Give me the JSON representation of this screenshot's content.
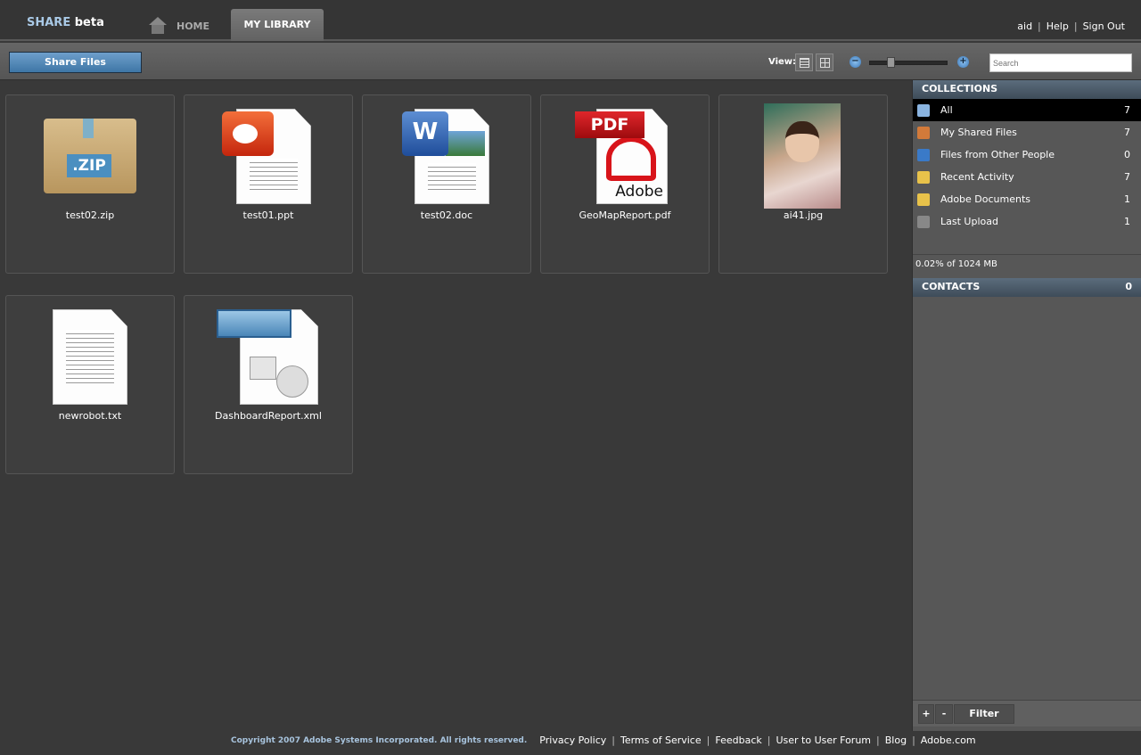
{
  "header": {
    "logo_share": "SHARE",
    "logo_beta": "beta",
    "tabs": [
      {
        "label": "HOME"
      },
      {
        "label": "MY LIBRARY",
        "active": true
      }
    ],
    "user": "aid",
    "help": "Help",
    "sign_out": "Sign Out"
  },
  "toolbar": {
    "share_files": "Share Files",
    "view_label": "View:",
    "search_placeholder": "Search",
    "zoom_level_fraction": 0.25
  },
  "files": [
    {
      "name": "test02.zip",
      "type": "zip",
      "badge": ".ZIP"
    },
    {
      "name": "test01.ppt",
      "type": "ppt"
    },
    {
      "name": "test02.doc",
      "type": "doc",
      "badge": "W"
    },
    {
      "name": "GeoMapReport.pdf",
      "type": "pdf",
      "badge": "PDF",
      "brand": "Adobe"
    },
    {
      "name": "ai41.jpg",
      "type": "jpg"
    },
    {
      "name": "newrobot.txt",
      "type": "txt"
    },
    {
      "name": "DashboardReport.xml",
      "type": "xml"
    }
  ],
  "sidebar": {
    "collections_title": "COLLECTIONS",
    "collections": [
      {
        "label": "All",
        "count": "7",
        "selected": true,
        "icon": "stack-icon"
      },
      {
        "label": "My Shared Files",
        "count": "7",
        "icon": "shared-user-icon"
      },
      {
        "label": "Files from Other People",
        "count": "0",
        "icon": "people-icon"
      },
      {
        "label": "Recent Activity",
        "count": "7",
        "icon": "note-icon"
      },
      {
        "label": "Adobe Documents",
        "count": "1",
        "icon": "note-icon"
      },
      {
        "label": "Last Upload",
        "count": "1",
        "icon": "binoculars-icon"
      }
    ],
    "storage": "0.02% of 1024 MB",
    "contacts_title": "CONTACTS",
    "contacts_count": "0",
    "add": "+",
    "remove": "-",
    "filter": "Filter"
  },
  "footer": {
    "copyright": "Copyright 2007 Adobe Systems Incorporated. All rights reserved.",
    "links": [
      "Privacy Policy",
      "Terms of Service",
      "Feedback",
      "User to User Forum",
      "Blog",
      "Adobe.com"
    ]
  },
  "colors": {
    "accent": "#4a84b8",
    "selected_row": "#000000",
    "header_bar": "#4a5a68"
  }
}
